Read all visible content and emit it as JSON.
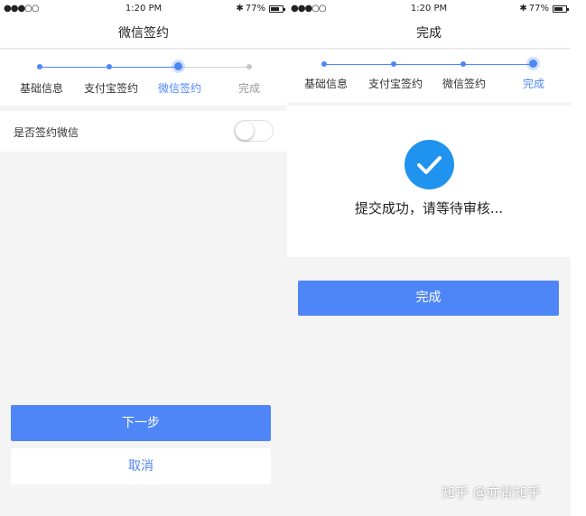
{
  "status": {
    "signal": "●●●○○",
    "time": "1:20 PM",
    "bluetooth": "✱",
    "battery_pct": "77%",
    "battery_level": 0.77
  },
  "colors": {
    "accent": "#4f86f7",
    "success": "#1f93ee",
    "background": "#f4f4f4"
  },
  "left": {
    "title": "微信签约",
    "steps": [
      "基础信息",
      "支付宝签约",
      "微信签约",
      "完成"
    ],
    "active_step": 2,
    "setting_label": "是否签约微信",
    "setting_on": false,
    "next_label": "下一步",
    "cancel_label": "取消"
  },
  "right": {
    "title": "完成",
    "steps": [
      "基础信息",
      "支付宝签约",
      "微信签约",
      "完成"
    ],
    "active_step": 3,
    "success_icon": "checkmark-icon",
    "success_message": "提交成功，请等待审核...",
    "done_label": "完成"
  },
  "watermark": "知乎 @亦青知乎"
}
